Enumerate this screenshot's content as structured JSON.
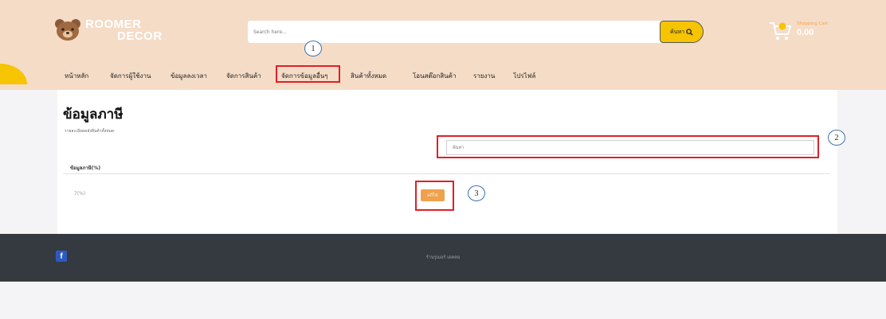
{
  "brand": {
    "line1": "ROOMER",
    "line2": "DECOR"
  },
  "search": {
    "placeholder": "Search here...",
    "button_label": "ค้นหา"
  },
  "cart": {
    "label": "Shopping Cart",
    "total": "0.00"
  },
  "nav": {
    "items": [
      {
        "label": "หน้าหลัก"
      },
      {
        "label": "จัดการผู้ใช้งาน"
      },
      {
        "label": "ข้อมูลลงเวลา"
      },
      {
        "label": "จัดการสินค้า"
      },
      {
        "label": "จัดการข้อมูลอื่นๆ"
      },
      {
        "label": "สินค้าทั้งหมด"
      },
      {
        "label": "โอนสต๊อกสินค้า"
      },
      {
        "label": "รายงาน"
      },
      {
        "label": "โปรไฟล์"
      }
    ]
  },
  "annotations": {
    "step1": "1",
    "step2": "2",
    "step3": "3"
  },
  "main": {
    "title": "ข้อมูลภาษี",
    "subtitle": "รายละเอียดคลังสินค้าทั้งหมด",
    "filter_placeholder": "ค้นหา",
    "table": {
      "column_header": "ข้อมูลภาษี(%)",
      "rows": [
        {
          "value": "7(%)",
          "action_label": "แก้ไข"
        }
      ]
    }
  },
  "footer": {
    "copyright": "ร้านรูเมอร์ เดคคอ"
  },
  "colors": {
    "header_bg": "#f5dcc7",
    "accent_yellow": "#f6c400",
    "edit_orange": "#f0a14b",
    "footer_bg": "#343a40",
    "annotation_red": "#e01f26"
  }
}
